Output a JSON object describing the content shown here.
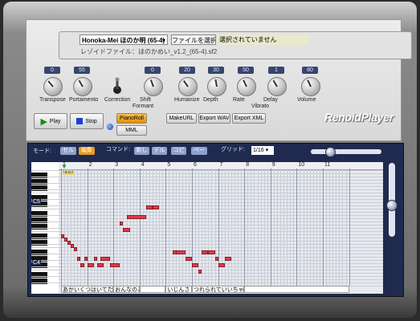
{
  "top": {
    "voice_select": "Honoka-Mei ほのか明 (65-4)",
    "file_button": "ファイルを選択",
    "file_status": "選択されていません",
    "sf2_line": "レゾイドファイル：ほのかめい_v1.2_(65-4).sf2"
  },
  "knobs": [
    {
      "label": "Transpose",
      "value": "0"
    },
    {
      "label": "Portamento",
      "value": "55"
    },
    {
      "label": "Correction",
      "value": ""
    },
    {
      "label": "Shift",
      "value": "0"
    },
    {
      "label": "Humanize",
      "value": "20"
    },
    {
      "label": "Depth",
      "value": "30"
    },
    {
      "label": "Rate",
      "value": "50"
    },
    {
      "label": "Delay",
      "value": "1"
    },
    {
      "label": "Volume",
      "value": "80"
    }
  ],
  "group_labels": {
    "formant": "Formant",
    "vibrato": "Vibrato"
  },
  "transport": {
    "play": "Play",
    "stop": "Stop",
    "pianoroll": "PianoRoll",
    "mml": "MML"
  },
  "exports": {
    "makeurl": "MakeURL",
    "wav": "Export WAV",
    "xml": "Export XML"
  },
  "logo": "RenoidPlayer",
  "editor": {
    "mode_label": "モード:",
    "mode_select": "セル",
    "mode_edit": "編集",
    "command_label": "コマンド:",
    "cmd_new": "新し",
    "cmd_del": "デル",
    "cmd_copy": "コピ",
    "cmd_paste": "ペー",
    "grid_label": "グリッド:",
    "grid_value": "1/16 ▾",
    "start_marker": "0000",
    "octaves": [
      "C5",
      "C4"
    ],
    "measures": [
      "1",
      "2",
      "3",
      "4",
      "5",
      "6",
      "7",
      "8",
      "9",
      "10",
      "11"
    ],
    "lyrics": [
      "あかいくつはいてた",
      "おんなのこ",
      "",
      "いじんさ",
      "つれられていいちゃ",
      ""
    ],
    "colors": {
      "note": "#e13946",
      "editor_bg": "#1f2a4e",
      "mode_active": "#e79a1e"
    }
  },
  "notes": [
    [
      0,
      0,
      20
    ],
    [
      1,
      1,
      21
    ],
    [
      2,
      2,
      22
    ],
    [
      3,
      3,
      23
    ],
    [
      4,
      4,
      24
    ],
    [
      5,
      5,
      27
    ],
    [
      6,
      6,
      29
    ],
    [
      7,
      7,
      27
    ],
    [
      8,
      9,
      29
    ],
    [
      10,
      10,
      27
    ],
    [
      11,
      12,
      29
    ],
    [
      12,
      14,
      27
    ],
    [
      15,
      17,
      29
    ],
    [
      18,
      18,
      16
    ],
    [
      19,
      20,
      18
    ],
    [
      20,
      25,
      14
    ],
    [
      26,
      27,
      11
    ],
    [
      28,
      29,
      11
    ],
    [
      34,
      35,
      25
    ],
    [
      35,
      37,
      25
    ],
    [
      38,
      39,
      27
    ],
    [
      40,
      41,
      29
    ],
    [
      42,
      42,
      31
    ],
    [
      43,
      44,
      25
    ],
    [
      45,
      46,
      25
    ],
    [
      47,
      47,
      27
    ],
    [
      48,
      49,
      29
    ],
    [
      50,
      51,
      27
    ],
    [
      70,
      74,
      40
    ]
  ]
}
